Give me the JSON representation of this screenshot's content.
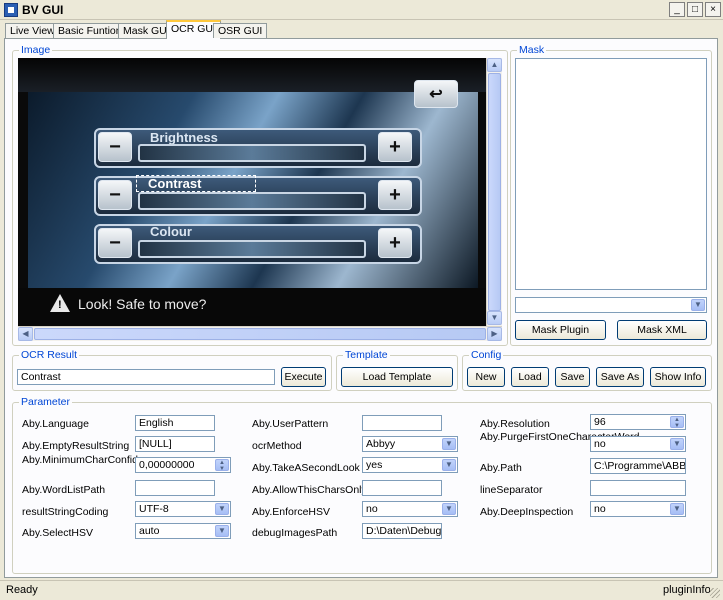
{
  "window": {
    "title": "BV GUI",
    "controls": {
      "minimize": "_",
      "maximize": "□",
      "close": "×"
    }
  },
  "tabs": [
    "Live View",
    "Basic Funtions",
    "Mask GUI",
    "OCR GUI",
    "OSR GUI"
  ],
  "active_tab": "OCR GUI",
  "groups": {
    "image": "Image",
    "mask": "Mask",
    "ocr_result": "OCR Result",
    "template": "Template",
    "config": "Config",
    "parameter": "Parameter"
  },
  "image_view": {
    "rows": [
      {
        "label": "Brightness",
        "minus": "−",
        "plus": "+"
      },
      {
        "label": "Contrast",
        "minus": "−",
        "plus": "+"
      },
      {
        "label": "Colour",
        "minus": "−",
        "plus": "+"
      }
    ],
    "warning": "Look! Safe to move?",
    "back_icon": "↩"
  },
  "mask": {
    "combo_value": "",
    "buttons": {
      "mask_plugin": "Mask Plugin",
      "mask_xml": "Mask XML"
    }
  },
  "ocr": {
    "result_value": "Contrast",
    "execute": "Execute"
  },
  "template": {
    "load": "Load Template"
  },
  "config": {
    "new": "New",
    "load": "Load",
    "save": "Save",
    "save_as": "Save As",
    "show_info": "Show Info"
  },
  "parameters": {
    "col1": [
      {
        "label": "Aby.Language",
        "value": "English",
        "type": "text"
      },
      {
        "label": "Aby.EmptyResultString",
        "value": "[NULL]",
        "type": "text"
      },
      {
        "label": "Aby.MinimumCharConfidence",
        "value": "0,00000000",
        "type": "spin"
      },
      {
        "label": "Aby.WordListPath",
        "value": "",
        "type": "text"
      },
      {
        "label": "resultStringCoding",
        "value": "UTF-8",
        "type": "combo"
      },
      {
        "label": "Aby.SelectHSV",
        "value": "auto",
        "type": "combo"
      }
    ],
    "col2": [
      {
        "label": "Aby.UserPattern",
        "value": "",
        "type": "text"
      },
      {
        "label": "ocrMethod",
        "value": "Abbyy",
        "type": "combo"
      },
      {
        "label": "Aby.TakeASecondLook",
        "value": "yes",
        "type": "combo"
      },
      {
        "label": "Aby.AllowThisCharsOnly",
        "value": "",
        "type": "text"
      },
      {
        "label": "Aby.EnforceHSV",
        "value": "no",
        "type": "combo"
      },
      {
        "label": "debugImagesPath",
        "value": "D:\\Daten\\DebugIm",
        "type": "text"
      }
    ],
    "col3": [
      {
        "label": "Aby.Resolution",
        "value": "96",
        "type": "spin"
      },
      {
        "label": "Aby.PurgeFirstOneCharacterWord",
        "value": "no",
        "type": "combo"
      },
      {
        "label": "Aby.Path",
        "value": "C:\\Programme\\ABB",
        "type": "text"
      },
      {
        "label": "lineSeparator",
        "value": "",
        "type": "text"
      },
      {
        "label": "Aby.DeepInspection",
        "value": "no",
        "type": "combo"
      }
    ]
  },
  "status": {
    "left": "Ready",
    "right": "pluginInfo"
  }
}
